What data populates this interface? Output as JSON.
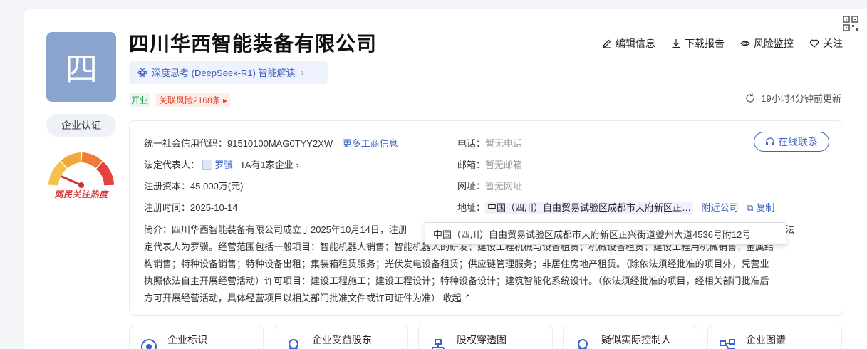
{
  "company": {
    "avatar_char": "四",
    "name": "四川华西智能装备有限公司",
    "certification": "企业认证",
    "gauge_label": "网民关注热度",
    "deepseek": "深度思考 (DeepSeek-R1) 智能解读",
    "status": "开业",
    "risk": "关联风险2168条"
  },
  "actions": {
    "edit": "编辑信息",
    "download": "下载报告",
    "monitor": "风险监控",
    "follow": "关注"
  },
  "update_time": "19小时4分钟前更新",
  "info": {
    "credit_code_label": "统一社会信用代码：",
    "credit_code": "91510100MAG0TYY2XW",
    "more_info": "更多工商信息",
    "legal_rep_label": "法定代表人：",
    "legal_rep": "罗骥",
    "legal_rep_extra_prefix": "TA有",
    "legal_rep_count": "1",
    "legal_rep_extra_suffix": "家企业",
    "capital_label": "注册资本：",
    "capital": "45,000万(元)",
    "reg_time_label": "注册时间：",
    "reg_time": "2025-10-14",
    "phone_label": "电话：",
    "phone": "暂无电话",
    "email_label": "邮箱：",
    "email": "暂无邮箱",
    "website_label": "网址：",
    "website": "暂无网址",
    "address_label": "地址：",
    "address": "中国（四川）自由贸易试验区成都市天府新区正…",
    "nearby": "附近公司",
    "copy": "复制",
    "chat_button": "在线联系",
    "intro_label": "简介：",
    "intro_line1_a": "四川华西智能装备有限公司成立于2025年10月14日，注册",
    "intro_line1_b": "2号，法",
    "intro_line2": "定代表人为罗骥。经营范围包括一般项目：智能机器人销售；智能机器人的研发；建设工程机械与设备租赁；机械设备租赁；建设工程用机械销售；金属结",
    "intro_line3": "构销售；特种设备销售；特种设备出租；集装箱租赁服务；光伏发电设备租赁；供应链管理服务；非居住房地产租赁。（除依法须经批准的项目外，凭营业",
    "intro_line4": "执照依法自主开展经营活动）许可项目：建设工程施工；建设工程设计；特种设备设计；建筑智能化系统设计。（依法须经批准的项目，经相关部门批准后",
    "intro_line5": "方可开展经营活动，具体经营项目以相关部门批准文件或许可证件为准）",
    "collapse": "收起"
  },
  "tooltip": "中国（四川）自由贸易试验区成都市天府新区正兴街道夔州大道4536号附12号",
  "tiles": [
    {
      "label": "企业标识"
    },
    {
      "label": "企业受益股东"
    },
    {
      "label": "股权穿透图"
    },
    {
      "label": "疑似实际控制人"
    },
    {
      "label": "企业图谱"
    }
  ],
  "colors": {
    "primary": "#3a63c7",
    "avatar": "#8ba3cf",
    "status_green": "#1a9a4a",
    "risk_red": "#e0402b"
  }
}
